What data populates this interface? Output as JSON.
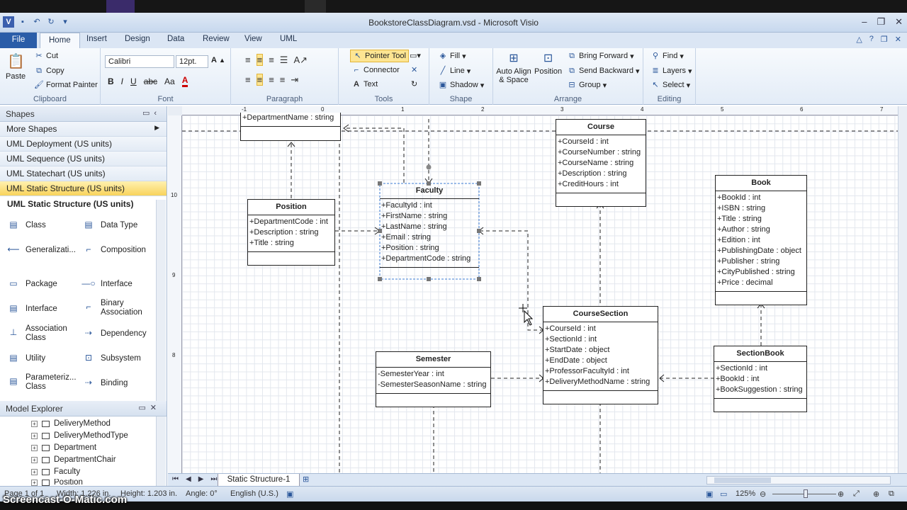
{
  "window": {
    "title": "BookstoreClassDiagram.vsd - Microsoft Visio"
  },
  "tabs": [
    "File",
    "Home",
    "Insert",
    "Design",
    "Data",
    "Review",
    "View",
    "UML"
  ],
  "ribbon": {
    "clipboard": {
      "label": "Clipboard",
      "paste": "Paste",
      "cut": "Cut",
      "copy": "Copy",
      "format_painter": "Format Painter"
    },
    "font": {
      "label": "Font",
      "family": "Calibri",
      "size": "12pt."
    },
    "paragraph": {
      "label": "Paragraph"
    },
    "tools": {
      "label": "Tools",
      "pointer": "Pointer Tool",
      "connector": "Connector",
      "text": "Text"
    },
    "shape": {
      "label": "Shape",
      "fill": "Fill",
      "line": "Line",
      "shadow": "Shadow"
    },
    "arrange": {
      "label": "Arrange",
      "auto_align": "Auto Align & Space",
      "position": "Position",
      "bring_forward": "Bring Forward",
      "send_backward": "Send Backward",
      "group": "Group"
    },
    "editing": {
      "label": "Editing",
      "find": "Find",
      "layers": "Layers",
      "select": "Select"
    }
  },
  "shapes_pane": {
    "title": "Shapes",
    "more_shapes": "More Shapes",
    "stencils": [
      "UML Deployment (US units)",
      "UML Sequence (US units)",
      "UML Statechart (US units)",
      "UML Static Structure (US units)"
    ],
    "section_title": "UML Static Structure (US units)",
    "items": [
      "Class",
      "Data Type",
      "Generalizati...",
      "Composition",
      "Package",
      "Interface",
      "Interface",
      "Binary Association",
      "Association Class",
      "Dependency",
      "Utility",
      "Subsystem",
      "Parameteriz... Class",
      "Binding"
    ]
  },
  "model_explorer": {
    "title": "Model Explorer",
    "items": [
      "DeliveryMethod",
      "DeliveryMethodType",
      "Department",
      "DepartmentChair",
      "Faculty",
      "Position"
    ]
  },
  "ruler": [
    "-1",
    "0",
    "1",
    "2",
    "3",
    "4",
    "5",
    "6",
    "7"
  ],
  "vruler": [
    "10",
    "9",
    "8"
  ],
  "classes": {
    "top": {
      "attrs": [
        "+DepartmentName : string"
      ]
    },
    "position": {
      "name": "Position",
      "attrs": [
        "+DepartmentCode : int",
        "+Description : string",
        "+Title : string"
      ]
    },
    "faculty": {
      "name": "Faculty",
      "attrs": [
        "+FacultyId : int",
        "+FirstName : string",
        "+LastName : string",
        "+Email : string",
        "+Position : string",
        "+DepartmentCode : string"
      ]
    },
    "course": {
      "name": "Course",
      "attrs": [
        "+CourseId : int",
        "+CourseNumber : string",
        "+CourseName : string",
        "+Description : string",
        "+CreditHours : int"
      ]
    },
    "book": {
      "name": "Book",
      "attrs": [
        "+BookId : int",
        "+ISBN : string",
        "+Title : string",
        "+Author : string",
        "+Edition : int",
        "+PublishingDate : object",
        "+Publisher : string",
        "+CityPublished : string",
        "+Price : decimal"
      ]
    },
    "semester": {
      "name": "Semester",
      "attrs": [
        "-SemesterYear : int",
        "-SemesterSeasonName : string"
      ]
    },
    "coursesection": {
      "name": "CourseSection",
      "attrs": [
        "+CourseId : int",
        "+SectionId : int",
        "+StartDate : object",
        "+EndDate : object",
        "+ProfessorFacultyId : int",
        "+DeliveryMethodName : string"
      ]
    },
    "sectionbook": {
      "name": "SectionBook",
      "attrs": [
        "+SectionId : int",
        "+BookId : int",
        "+BookSuggestion : string"
      ]
    }
  },
  "page_tab": "Static Structure-1",
  "status": {
    "page": "Page 1 of 1",
    "width": "Width: 1.226 in.",
    "height": "Height: 1.203 in.",
    "angle": "Angle: 0°",
    "language": "English (U.S.)",
    "zoom": "125%"
  },
  "watermark": "Screencast-O-Matic.com"
}
